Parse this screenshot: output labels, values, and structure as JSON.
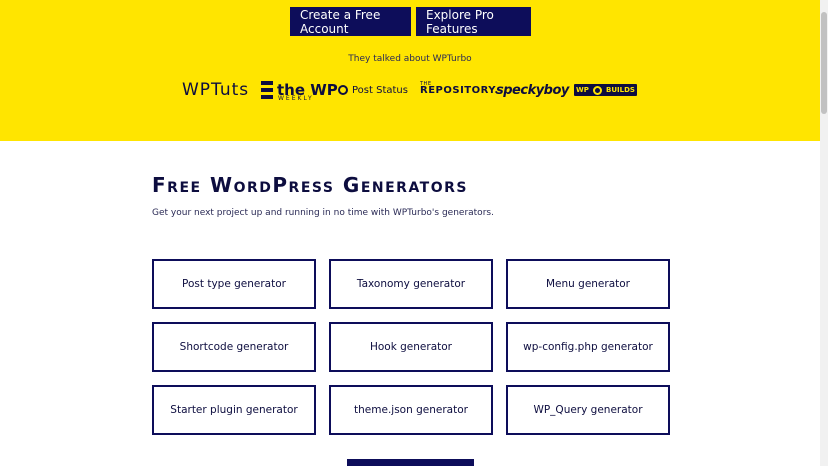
{
  "hero": {
    "cta_primary": "Create a Free Account",
    "cta_secondary": "Explore Pro Features",
    "talked_about": "They talked about WPTurbo",
    "background_color": "#ffe500"
  },
  "logos": {
    "wptuts": "WPTuts",
    "theweekly_main": "the WP",
    "theweekly_sub": "WEEKLY",
    "poststatus": "Post Status",
    "repository_the": "THE",
    "repository": "REPOSITORY.",
    "speckyboy": "speckyboy",
    "wpbuilds_left": "WP",
    "wpbuilds_right": "BUILDS"
  },
  "section": {
    "title": "Free WordPress Generators",
    "description": "Get your next project up and running in no time with WPTurbo's generators."
  },
  "generators": [
    "Post type generator",
    "Taxonomy generator",
    "Menu generator",
    "Shortcode generator",
    "Hook generator",
    "wp-config.php generator",
    "Starter plugin generator",
    "theme.json generator",
    "WP_Query generator"
  ],
  "colors": {
    "accent": "#ffe500",
    "navy": "#0d0d5a"
  }
}
